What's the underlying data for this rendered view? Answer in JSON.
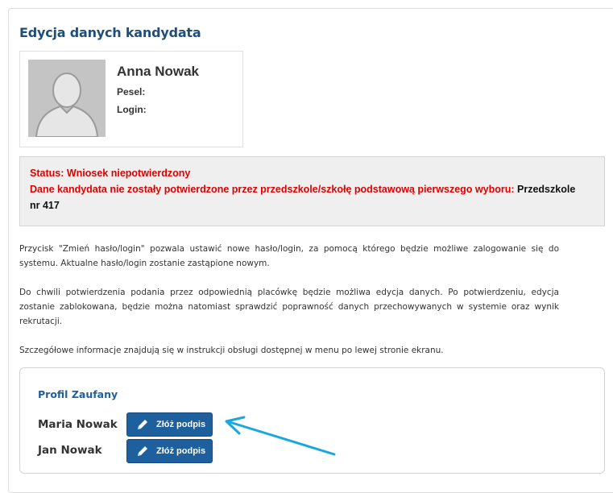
{
  "page": {
    "title": "Edycja danych kandydata"
  },
  "candidate": {
    "name": "Anna Nowak",
    "pesel_label": "Pesel:",
    "login_label": "Login:",
    "avatar_icon": "user-silhouette-icon"
  },
  "status": {
    "label": "Status: Wniosek niepotwierdzony",
    "message": "Dane kandydata nie zostały potwierdzone przez przedszkole/szkołę podstawową pierwszego wyboru:",
    "school_part1": "Przedszkole",
    "school_part2": "nr 417",
    "color": "#e00000"
  },
  "info": {
    "paragraphs": [
      "Przycisk \"Zmień hasło/login\" pozwala ustawić nowe hasło/login, za pomocą którego będzie możliwe zalogowanie się do systemu. Aktualne hasło/login zostanie zastąpione nowym.",
      "Do chwili potwierdzenia podania przez odpowiednią placówkę będzie możliwa edycja danych. Po potwierdzeniu, edycja zostanie zablokowana, będzie można natomiast sprawdzić poprawność danych przechowywanych w systemie oraz wynik rekrutacji.",
      "Szczegółowe informacje znajdują się w instrukcji obsługi dostępnej w menu po lewej stronie ekranu."
    ]
  },
  "profil": {
    "title": "Profil Zaufany",
    "signers": [
      {
        "name": "Maria Nowak",
        "button_label": "Złóż podpis",
        "icon": "pencil-icon"
      },
      {
        "name": "Jan Nowak",
        "button_label": "Złóż podpis",
        "icon": "pencil-icon"
      }
    ]
  },
  "colors": {
    "heading": "#1f4e79",
    "button": "#1e5f9e",
    "annotation_arrow": "#1aa7e0"
  }
}
